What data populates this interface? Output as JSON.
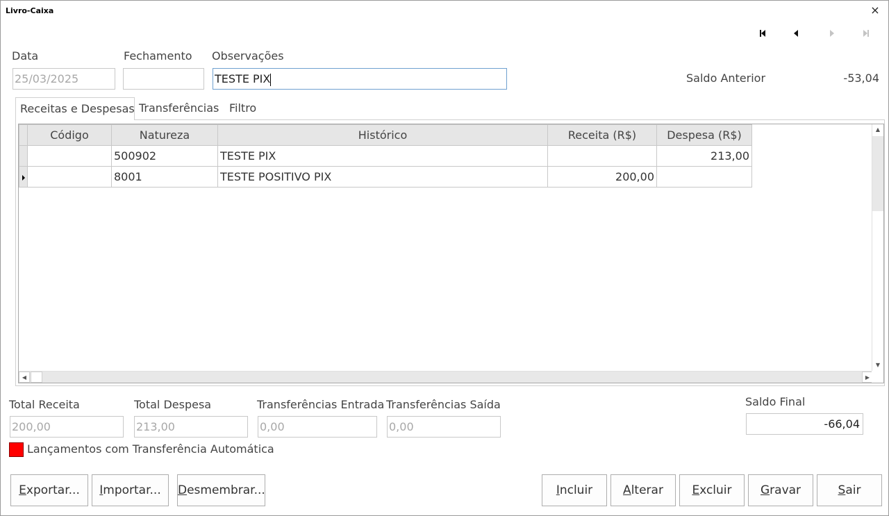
{
  "window": {
    "title": "Livro-Caixa",
    "close_label": "×"
  },
  "nav": [
    "first-record-icon",
    "previous-record-icon",
    "next-record-icon",
    "last-record-icon"
  ],
  "form": {
    "data_label": "Data",
    "data_value": "25/03/2025",
    "fechamento_label": "Fechamento",
    "fechamento_value": "",
    "observacoes_label": "Observações",
    "observacoes_value": "TESTE PIX",
    "saldo_anterior_label": "Saldo Anterior",
    "saldo_anterior_value": "-53,04"
  },
  "tabs": [
    {
      "label": "Receitas e Despesas",
      "selected": true
    },
    {
      "label": "Transferências",
      "selected": false
    },
    {
      "label": "Filtro",
      "selected": false
    }
  ],
  "grid": {
    "columns": [
      "Código",
      "Natureza",
      "Histórico",
      "Receita (R$)",
      "Despesa (R$)"
    ],
    "rows": [
      {
        "codigo": "",
        "natureza": "500902",
        "historico": "TESTE PIX",
        "receita": "",
        "despesa": "213,00",
        "current": false
      },
      {
        "codigo": "",
        "natureza": "8001",
        "historico": "TESTE POSITIVO PIX",
        "receita": "200,00",
        "despesa": "",
        "current": true
      }
    ]
  },
  "totals": {
    "total_receita_label": "Total Receita",
    "total_receita_value": "200,00",
    "total_despesa_label": "Total Despesa",
    "total_despesa_value": "213,00",
    "transf_entrada_label": "Transferências Entrada",
    "transf_entrada_value": "0,00",
    "transf_saida_label": "Transferências Saída",
    "transf_saida_value": "0,00",
    "saldo_final_label": "Saldo Final",
    "saldo_final_value": "-66,04"
  },
  "legend": {
    "label": "Lançamentos com Transferência Automática",
    "color": "#ff0000"
  },
  "buttons": {
    "exportar": {
      "u": "E",
      "rest": "xportar..."
    },
    "importar": {
      "u": "I",
      "rest": "mportar..."
    },
    "desmembrar": {
      "u": "D",
      "rest": "esmembrar..."
    },
    "incluir": {
      "u": "I",
      "rest": "ncluir"
    },
    "alterar": {
      "u": "A",
      "rest": "lterar"
    },
    "excluir": {
      "u": "E",
      "rest": "xcluir"
    },
    "gravar": {
      "u": "G",
      "rest": "ravar"
    },
    "sair": {
      "u": "S",
      "rest": "air"
    }
  }
}
